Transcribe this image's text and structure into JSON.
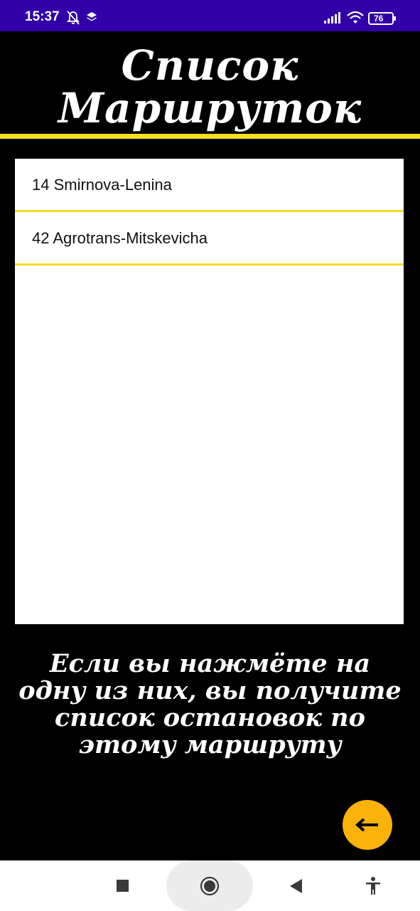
{
  "status_bar": {
    "time": "15:37",
    "battery_level": "76",
    "icons": [
      "bell-off-icon",
      "layers-icon",
      "signal-icon",
      "wifi-icon",
      "battery-icon"
    ],
    "background_color": "#3100a8"
  },
  "header": {
    "title_line1": "Список",
    "title_line2": "Маршруток",
    "divider_color": "#f4dd23"
  },
  "routes": [
    {
      "label": "14 Smirnova-Lenina"
    },
    {
      "label": "42 Agrotrans-Mitskevicha"
    }
  ],
  "hint": {
    "line1": "Если вы нажмёте на",
    "line2": "одну из них, вы получите",
    "line3": "список остановок по",
    "line4": "этому маршруту"
  },
  "fab": {
    "icon": "arrow-left-icon",
    "color": "#fbb30b"
  },
  "nav_bar": {
    "icons": [
      "recent-apps-icon",
      "home-icon",
      "back-icon",
      "accessibility-icon"
    ]
  },
  "colors": {
    "background": "#000000",
    "accent": "#f4dd23",
    "list_background": "#ffffff"
  }
}
